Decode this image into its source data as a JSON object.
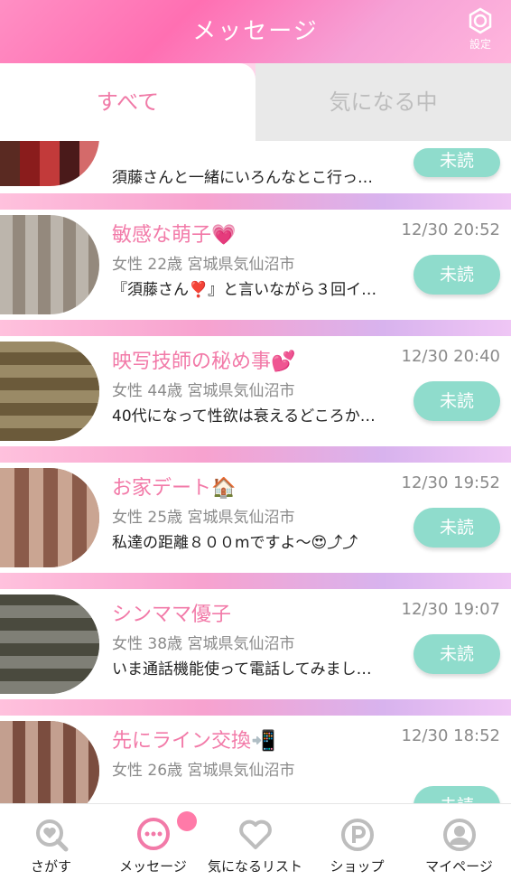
{
  "header": {
    "title": "メッセージ",
    "settings_label": "設定"
  },
  "tabs": [
    {
      "label": "すべて",
      "active": true
    },
    {
      "label": "気になる中",
      "active": false
    }
  ],
  "messages": [
    {
      "name": "",
      "time": "",
      "meta": "",
      "preview": "須藤さんと一緒にいろんなとこ行っ…",
      "status": "未読"
    },
    {
      "name": "敏感な萌子💗",
      "time": "12/30 20:52",
      "meta": "女性 22歳 宮城県気仙沼市",
      "preview": "『須藤さん❣️』と言いながら３回イ…",
      "status": "未読"
    },
    {
      "name": "映写技師の秘め事💕",
      "time": "12/30 20:40",
      "meta": "女性 44歳 宮城県気仙沼市",
      "preview": "40代になって性欲は衰えるどころか…",
      "status": "未読"
    },
    {
      "name": "お家デート🏠",
      "time": "12/30 19:52",
      "meta": "女性 25歳 宮城県気仙沼市",
      "preview": "私達の距離８００mですよ〜😍⤴⤴",
      "status": "未読"
    },
    {
      "name": "シンママ優子",
      "time": "12/30 19:07",
      "meta": "女性 38歳 宮城県気仙沼市",
      "preview": "いま通話機能使って電話してみまし…",
      "status": "未読"
    },
    {
      "name": "先にライン交換📲",
      "time": "12/30 18:52",
      "meta": "女性 26歳 宮城県気仙沼市",
      "preview": "",
      "status": "未読"
    }
  ],
  "bottom_nav": [
    {
      "label": "さがす",
      "icon": "search-heart-icon"
    },
    {
      "label": "メッセージ",
      "icon": "chat-bubble-icon",
      "active": true
    },
    {
      "label": "気になるリスト",
      "icon": "heart-icon"
    },
    {
      "label": "ショップ",
      "icon": "points-icon"
    },
    {
      "label": "マイページ",
      "icon": "user-icon"
    }
  ],
  "colors": {
    "accent": "#f27aa8",
    "unread": "#8fdccc",
    "header": "#ff7fbd"
  }
}
